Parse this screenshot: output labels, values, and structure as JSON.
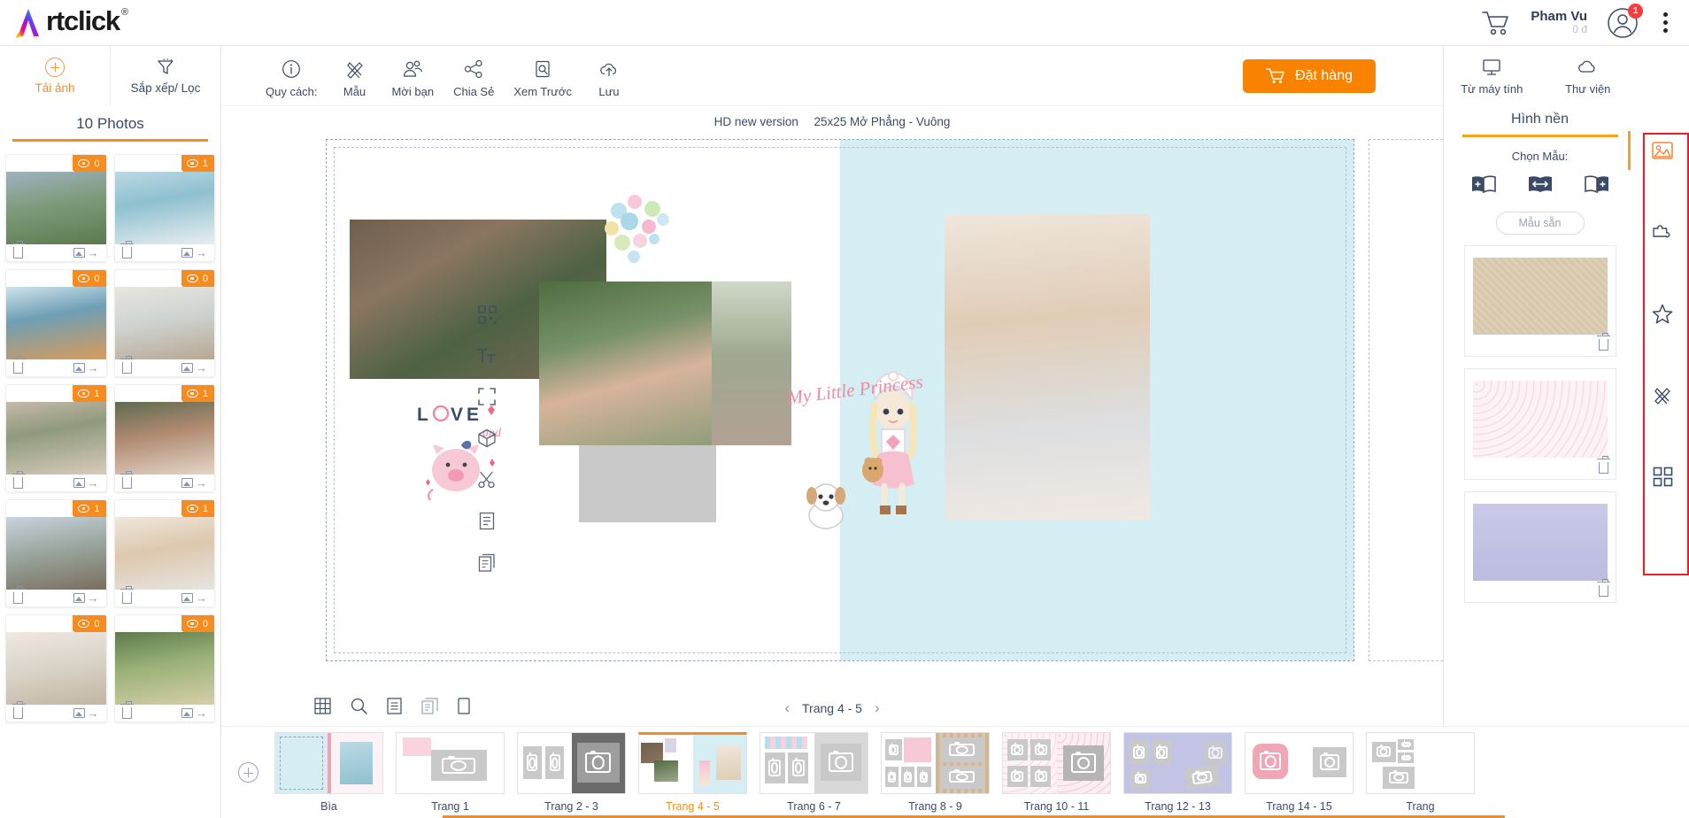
{
  "brand": {
    "name": "rtclick",
    "registered": "®"
  },
  "topbar": {
    "cart_icon": "cart-icon",
    "user_name": "Pham Vu",
    "user_balance": "0 đ",
    "notification_count": "1",
    "menu_icon": "kebab-menu-icon"
  },
  "left_panel": {
    "actions": [
      {
        "label": "Tải ảnh",
        "icon": "plus-circle-icon",
        "active": true
      },
      {
        "label": "Sắp xếp/ Lọc",
        "icon": "filter-icon",
        "active": false
      }
    ],
    "photos_count_label": "10 Photos",
    "photos": [
      {
        "uses": "0",
        "alt": "boy-kicking-by-lake"
      },
      {
        "uses": "1",
        "alt": "girl-at-railing-by-sea"
      },
      {
        "uses": "0",
        "alt": "people-on-boat"
      },
      {
        "uses": "0",
        "alt": "two-kids-in-corridor"
      },
      {
        "uses": "1",
        "alt": "kids-on-street"
      },
      {
        "uses": "1",
        "alt": "woman-portrait"
      },
      {
        "uses": "1",
        "alt": "street-with-buildings"
      },
      {
        "uses": "1",
        "alt": "child-with-cardboard-box"
      },
      {
        "uses": "0",
        "alt": "living-room-sofa"
      },
      {
        "uses": "0",
        "alt": "two-children-outdoors"
      }
    ],
    "card_icons": {
      "delete": "trash-icon",
      "replace": "image-swap-icon"
    }
  },
  "main_toolbar": {
    "items": [
      {
        "label": "Quy cách:",
        "icon": "info-icon"
      },
      {
        "label": "Mẫu",
        "icon": "pencil-brush-icon"
      },
      {
        "label": "Mời bạn",
        "icon": "invite-friend-icon"
      },
      {
        "label": "Chia Sẻ",
        "icon": "share-icon"
      },
      {
        "label": "Xem Trước",
        "icon": "preview-search-icon"
      },
      {
        "label": "Lưu",
        "icon": "upload-cloud-icon"
      }
    ],
    "order_button": {
      "label": "Đặt hàng",
      "icon": "cart-icon",
      "color": "#f98200"
    }
  },
  "canvas": {
    "title_left": "HD new version",
    "title_right": "25x25 Mở Phẳng - Vuông",
    "spread_bg_right": "#d4eef3",
    "clipart_text": "My Little Princess",
    "love_text": "LOVE",
    "love_sub": "and",
    "left_rail_icons": [
      "qr-code-icon",
      "text-tool-icon",
      "crop-frame-icon",
      "3d-box-icon",
      "scissors-icon",
      "page-icon",
      "duplicate-page-icon"
    ],
    "bottom_icons": [
      "grid-icon",
      "zoom-icon",
      "list-icon",
      "copy-icon",
      "single-page-icon"
    ],
    "pager": {
      "prev": "‹",
      "label": "Trang 4 - 5",
      "next": "›"
    }
  },
  "right_panel": {
    "sources": [
      {
        "label": "Từ máy tính",
        "icon": "monitor-icon"
      },
      {
        "label": "Thư viện",
        "icon": "cloud-icon"
      }
    ],
    "tab_title": "Hình nền",
    "choose_label": "Chọn Mẫu:",
    "modes": [
      {
        "icon": "apply-left-page-icon"
      },
      {
        "icon": "apply-spread-icon"
      },
      {
        "icon": "apply-right-page-icon"
      }
    ],
    "preset_button": "Mẫu sẵn",
    "swatches": [
      {
        "name": "beige-linen",
        "color": "#ddcfb6"
      },
      {
        "name": "pink-dot",
        "color": "#fbeef1"
      },
      {
        "name": "lavender",
        "color": "#c9c9e8"
      }
    ],
    "swatch_delete_icon": "trash-icon"
  },
  "icon_rail": {
    "highlight_color": "#ee1c25",
    "items": [
      {
        "icon": "image-icon",
        "active": true
      },
      {
        "icon": "puzzle-icon",
        "active": false
      },
      {
        "icon": "star-icon",
        "active": false
      },
      {
        "icon": "pencil-brush-icon",
        "active": false
      },
      {
        "icon": "layout-grid-icon",
        "active": false
      }
    ]
  },
  "page_strip": {
    "add_icon": "plus-circle-icon",
    "pages": [
      {
        "label": "Bìa",
        "selected": false,
        "style": "cover"
      },
      {
        "label": "Trang 1",
        "selected": false,
        "style": "p1"
      },
      {
        "label": "Trang 2 - 3",
        "selected": false,
        "style": "p23"
      },
      {
        "label": "Trang 4 - 5",
        "selected": true,
        "style": "p45"
      },
      {
        "label": "Trang 6 - 7",
        "selected": false,
        "style": "p67"
      },
      {
        "label": "Trang 8 - 9",
        "selected": false,
        "style": "p89"
      },
      {
        "label": "Trang 10 - 11",
        "selected": false,
        "style": "p1011"
      },
      {
        "label": "Trang 12 - 13",
        "selected": false,
        "style": "p1213"
      },
      {
        "label": "Trang 14 - 15",
        "selected": false,
        "style": "p1415"
      },
      {
        "label": "Trang",
        "selected": false,
        "style": "p1617"
      }
    ]
  }
}
